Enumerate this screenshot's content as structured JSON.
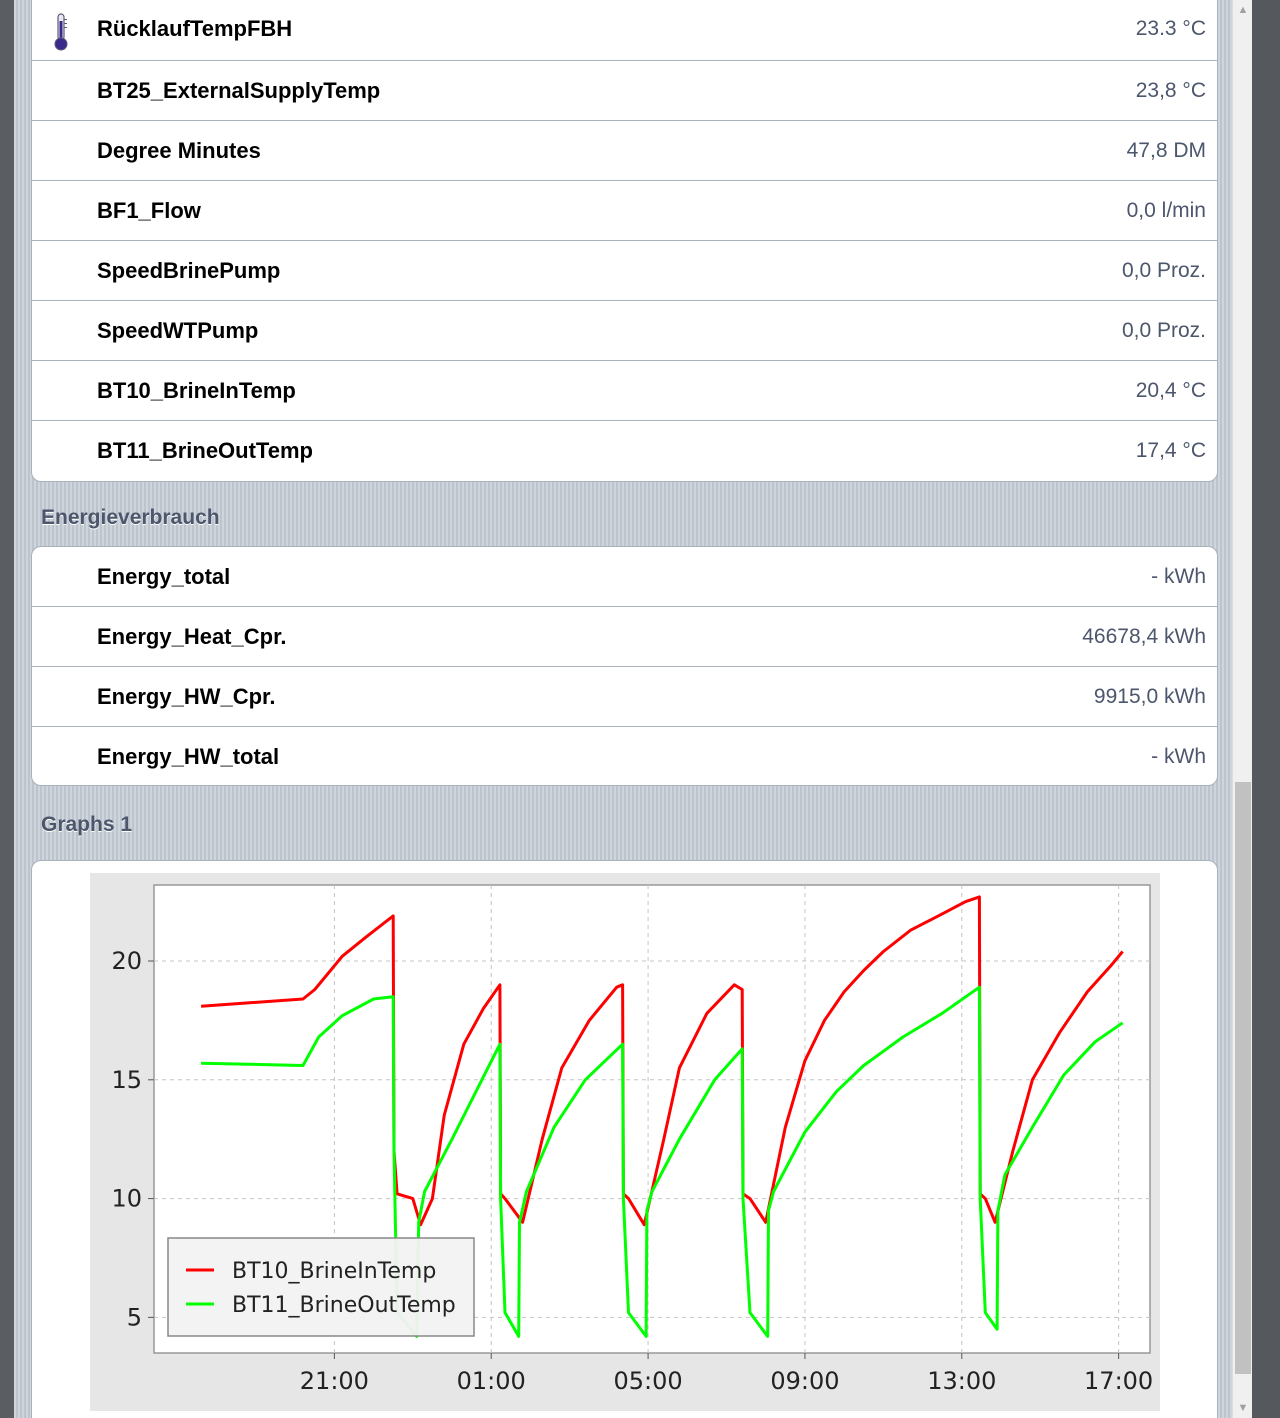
{
  "readings": [
    {
      "label": "RücklaufTempFBH",
      "value": "23.3 °C",
      "icon": "thermometer-icon"
    },
    {
      "label": "BT25_ExternalSupplyTemp",
      "value": "23,8 °C"
    },
    {
      "label": "Degree Minutes",
      "value": "47,8 DM"
    },
    {
      "label": "BF1_Flow",
      "value": "0,0 l/min"
    },
    {
      "label": "SpeedBrinePump",
      "value": "0,0 Proz."
    },
    {
      "label": "SpeedWTPump",
      "value": "0,0 Proz."
    },
    {
      "label": "BT10_BrineInTemp",
      "value": "20,4 °C"
    },
    {
      "label": "BT11_BrineOutTemp",
      "value": "17,4 °C"
    }
  ],
  "energy": {
    "title": "Energieverbrauch",
    "items": [
      {
        "label": "Energy_total",
        "value": "- kWh"
      },
      {
        "label": "Energy_Heat_Cpr.",
        "value": "46678,4 kWh"
      },
      {
        "label": "Energy_HW_Cpr.",
        "value": "9915,0 kWh"
      },
      {
        "label": "Energy_HW_total",
        "value": "- kWh"
      }
    ]
  },
  "graphs": {
    "title": "Graphs 1"
  },
  "colors": {
    "series_in": "#ff0000",
    "series_out": "#00ff00",
    "value_text": "#4c566c"
  },
  "chart_data": {
    "type": "line",
    "x_unit": "hours since 17:00 previous day",
    "xticks": [
      {
        "x": 4,
        "label": "21:00"
      },
      {
        "x": 8,
        "label": "01:00"
      },
      {
        "x": 12,
        "label": "05:00"
      },
      {
        "x": 16,
        "label": "09:00"
      },
      {
        "x": 20,
        "label": "13:00"
      },
      {
        "x": 24,
        "label": "17:00"
      }
    ],
    "yticks": [
      5,
      10,
      15,
      20
    ],
    "xlim": [
      -0.6,
      24.8
    ],
    "ylim": [
      3.5,
      23.2
    ],
    "grid": true,
    "legend_position": "bottom-left",
    "series": [
      {
        "name": "BT10_BrineInTemp",
        "color": "#ff0000",
        "x": [
          0.6,
          3.2,
          3.5,
          4.2,
          4.8,
          5.5,
          5.52,
          5.6,
          6.0,
          6.2,
          6.5,
          6.8,
          7.3,
          7.8,
          8.22,
          8.24,
          8.35,
          8.8,
          9.3,
          9.8,
          10.5,
          11.2,
          11.35,
          11.37,
          11.5,
          11.9,
          12.4,
          12.8,
          13.5,
          14.2,
          14.4,
          14.42,
          14.6,
          15.0,
          15.5,
          16.0,
          16.5,
          17.0,
          17.5,
          18.0,
          18.7,
          19.4,
          20.1,
          20.45,
          20.47,
          20.6,
          20.85,
          21.3,
          21.8,
          22.5,
          23.2,
          23.8,
          24.1
        ],
        "y": [
          18.1,
          18.4,
          18.8,
          20.2,
          21.0,
          21.9,
          12.0,
          10.2,
          10.0,
          8.9,
          10.0,
          13.5,
          16.5,
          18.0,
          19.0,
          10.2,
          10.0,
          9.0,
          12.5,
          15.5,
          17.5,
          18.9,
          19.0,
          10.2,
          10.0,
          8.9,
          12.5,
          15.5,
          17.8,
          19.0,
          18.8,
          10.2,
          10.0,
          9.0,
          13.0,
          15.8,
          17.5,
          18.7,
          19.6,
          20.4,
          21.3,
          21.9,
          22.5,
          22.7,
          10.2,
          10.0,
          9.0,
          12.0,
          15.0,
          17.0,
          18.7,
          19.8,
          20.4
        ]
      },
      {
        "name": "BT11_BrineOutTemp",
        "color": "#00ff00",
        "x": [
          0.6,
          3.2,
          3.6,
          4.2,
          5.0,
          5.5,
          5.52,
          5.6,
          6.1,
          6.15,
          6.3,
          7.0,
          7.7,
          8.22,
          8.24,
          8.35,
          8.7,
          8.72,
          8.9,
          9.6,
          10.4,
          11.35,
          11.37,
          11.5,
          11.95,
          11.97,
          12.1,
          12.8,
          13.7,
          14.4,
          14.42,
          14.6,
          15.05,
          15.07,
          15.2,
          16.0,
          16.8,
          17.5,
          18.5,
          19.5,
          20.45,
          20.47,
          20.6,
          20.9,
          20.92,
          21.1,
          21.8,
          22.6,
          23.4,
          24.1
        ],
        "y": [
          15.7,
          15.6,
          16.8,
          17.7,
          18.4,
          18.5,
          12.0,
          5.2,
          4.2,
          9.0,
          10.3,
          12.5,
          14.8,
          16.5,
          10.0,
          5.2,
          4.2,
          9.0,
          10.3,
          13.0,
          15.0,
          16.5,
          10.0,
          5.2,
          4.2,
          9.5,
          10.3,
          12.5,
          15.0,
          16.3,
          10.0,
          5.2,
          4.2,
          9.5,
          10.3,
          12.8,
          14.5,
          15.6,
          16.8,
          17.8,
          18.9,
          10.0,
          5.2,
          4.5,
          9.5,
          11.0,
          13.0,
          15.2,
          16.6,
          17.4
        ]
      }
    ]
  }
}
